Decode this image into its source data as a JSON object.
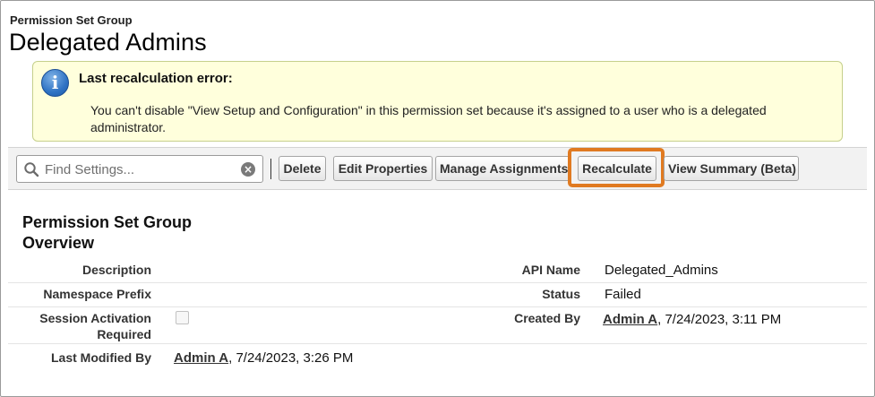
{
  "header": {
    "breadcrumb": "Permission Set Group",
    "title": "Delegated Admins"
  },
  "alert": {
    "icon": "info-icon",
    "title": "Last recalculation error:",
    "message": "You can't disable \"View Setup and Configuration\" in this permission set because it's assigned to a user who is a delegated administrator."
  },
  "toolbar": {
    "search_placeholder": "Find Settings...",
    "buttons": {
      "delete": "Delete",
      "edit_properties": "Edit Properties",
      "manage_assignments": "Manage Assignments",
      "recalculate": "Recalculate",
      "view_summary": "View Summary (Beta)"
    },
    "highlight_color": "#e07a21"
  },
  "overview": {
    "title": "Permission Set Group Overview",
    "fields": {
      "description_label": "Description",
      "description_value": "",
      "api_name_label": "API Name",
      "api_name_value": "Delegated_Admins",
      "namespace_label": "Namespace Prefix",
      "namespace_value": "",
      "status_label": "Status",
      "status_value": "Failed",
      "session_label": "Session Activation Required",
      "session_checked": false,
      "created_by_label": "Created By",
      "created_by_user": "Admin A",
      "created_by_date": ", 7/24/2023, 3:11 PM",
      "modified_label": "Last Modified By",
      "modified_user": "Admin A",
      "modified_date": ", 7/24/2023, 3:26 PM"
    }
  }
}
